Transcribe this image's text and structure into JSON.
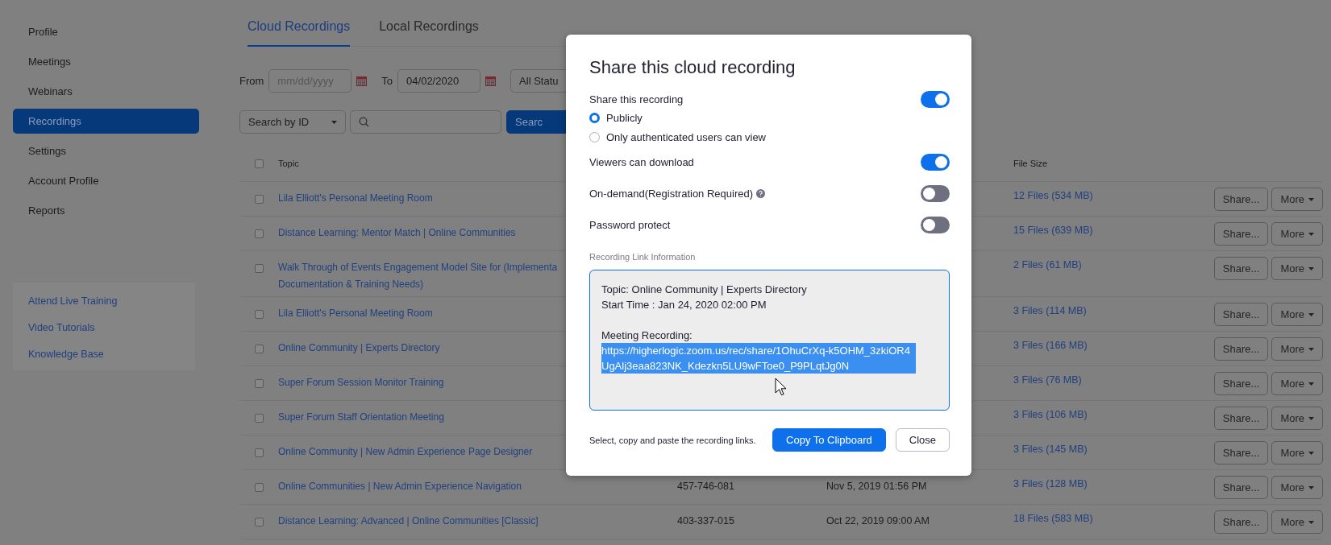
{
  "sidebar": {
    "items": [
      {
        "label": "Profile",
        "selected": false
      },
      {
        "label": "Meetings",
        "selected": false
      },
      {
        "label": "Webinars",
        "selected": false
      },
      {
        "label": "Recordings",
        "selected": true
      },
      {
        "label": "Settings",
        "selected": false
      },
      {
        "label": "Account Profile",
        "selected": false
      },
      {
        "label": "Reports",
        "selected": false
      }
    ],
    "help_links": [
      "Attend Live Training",
      "Video Tutorials",
      "Knowledge Base"
    ]
  },
  "tabs": [
    {
      "label": "Cloud Recordings",
      "selected": true
    },
    {
      "label": "Local Recordings",
      "selected": false
    }
  ],
  "filters": {
    "from_label": "From",
    "from_placeholder": "mm/dd/yyyy",
    "to_label": "To",
    "to_value": "04/02/2020",
    "status": "All Statu"
  },
  "search": {
    "by_label": "Search by",
    "by_value": "ID",
    "button": "Searc"
  },
  "table": {
    "header_checked": false,
    "columns": [
      "Topic",
      "File Size"
    ],
    "rows": [
      {
        "topic": [
          "Lila Elliott's Personal Meeting Room"
        ],
        "size": "12 Files (534 MB)",
        "checked": false
      },
      {
        "topic": [
          "Distance Learning: Mentor Match | Online Communities"
        ],
        "size": "15 Files (639 MB)",
        "checked": false
      },
      {
        "topic": [
          "Walk Through of Events Engagement Model Site for (Implementa",
          "Documentation & Training Needs)"
        ],
        "size": "2 Files (61 MB)",
        "checked": false
      },
      {
        "topic": [
          "Lila Elliott's Personal Meeting Room"
        ],
        "size": "3 Files (114 MB)",
        "checked": false
      },
      {
        "topic": [
          "Online Community | Experts Directory"
        ],
        "size": "3 Files (166 MB)",
        "checked": false
      },
      {
        "topic": [
          "Super Forum Session Monitor Training"
        ],
        "size": "3 Files (76 MB)",
        "checked": false
      },
      {
        "topic": [
          "Super Forum Staff Orientation Meeting"
        ],
        "size": "3 Files (106 MB)",
        "checked": false
      },
      {
        "topic": [
          "Online Community | New Admin Experience Page Designer"
        ],
        "size": "3 Files (145 MB)",
        "checked": false
      },
      {
        "topic": [
          "Online Communities | New Admin Experience Navigation"
        ],
        "id": "457-746-081",
        "start_time": "Nov 5, 2019 01:56 PM",
        "size": "3 Files (128 MB)",
        "checked": false
      },
      {
        "topic": [
          "Distance Learning: Advanced | Online Communities [Classic]"
        ],
        "id": "403-337-015",
        "start_time": "Oct 22, 2019 09:00 AM",
        "size": "18 Files (583 MB)",
        "checked": false
      }
    ],
    "share_buttons": [
      "Share...",
      "Share...",
      "Share...",
      "Share...",
      "Share...",
      "Share...",
      "Share...",
      "Share...",
      "Share...",
      "Share..."
    ],
    "more_buttons": [
      "More",
      "More",
      "More",
      "More",
      "More",
      "More",
      "More",
      "More",
      "More",
      "More"
    ]
  },
  "dialog": {
    "title": "Share this cloud recording",
    "settings": [
      {
        "kind": "toggle",
        "label": "Share this recording",
        "on": true
      },
      {
        "kind": "radio",
        "label": "Publicly",
        "selected": true
      },
      {
        "kind": "radio",
        "label": "Only authenticated users can view",
        "selected": false
      },
      {
        "kind": "toggle",
        "label": "Viewers can download",
        "on": true
      },
      {
        "kind": "toggle",
        "label": "On-demand(Registration Required)",
        "on": false,
        "help": true
      },
      {
        "kind": "toggle",
        "label": "Password protect",
        "on": false
      }
    ],
    "link_info_label": "Recording Link Information",
    "link_info": {
      "lines": [
        "Topic: Online Community | Experts Directory",
        "Start Time : Jan 24, 2020 02:00 PM"
      ],
      "link_heading": "Meeting Recording:",
      "link": "https://higherlogic.zoom.us/rec/share/1OhuCrXq-k5OHM_3zkiOR4UgAlj3eaa823NK_Kdezkn5LU9wFToe0_P9PLqtJg0N",
      "link_selected": true
    },
    "hint": "Select, copy and paste the recording links.",
    "copy_button": "Copy To Clipboard",
    "close_button": "Close"
  }
}
